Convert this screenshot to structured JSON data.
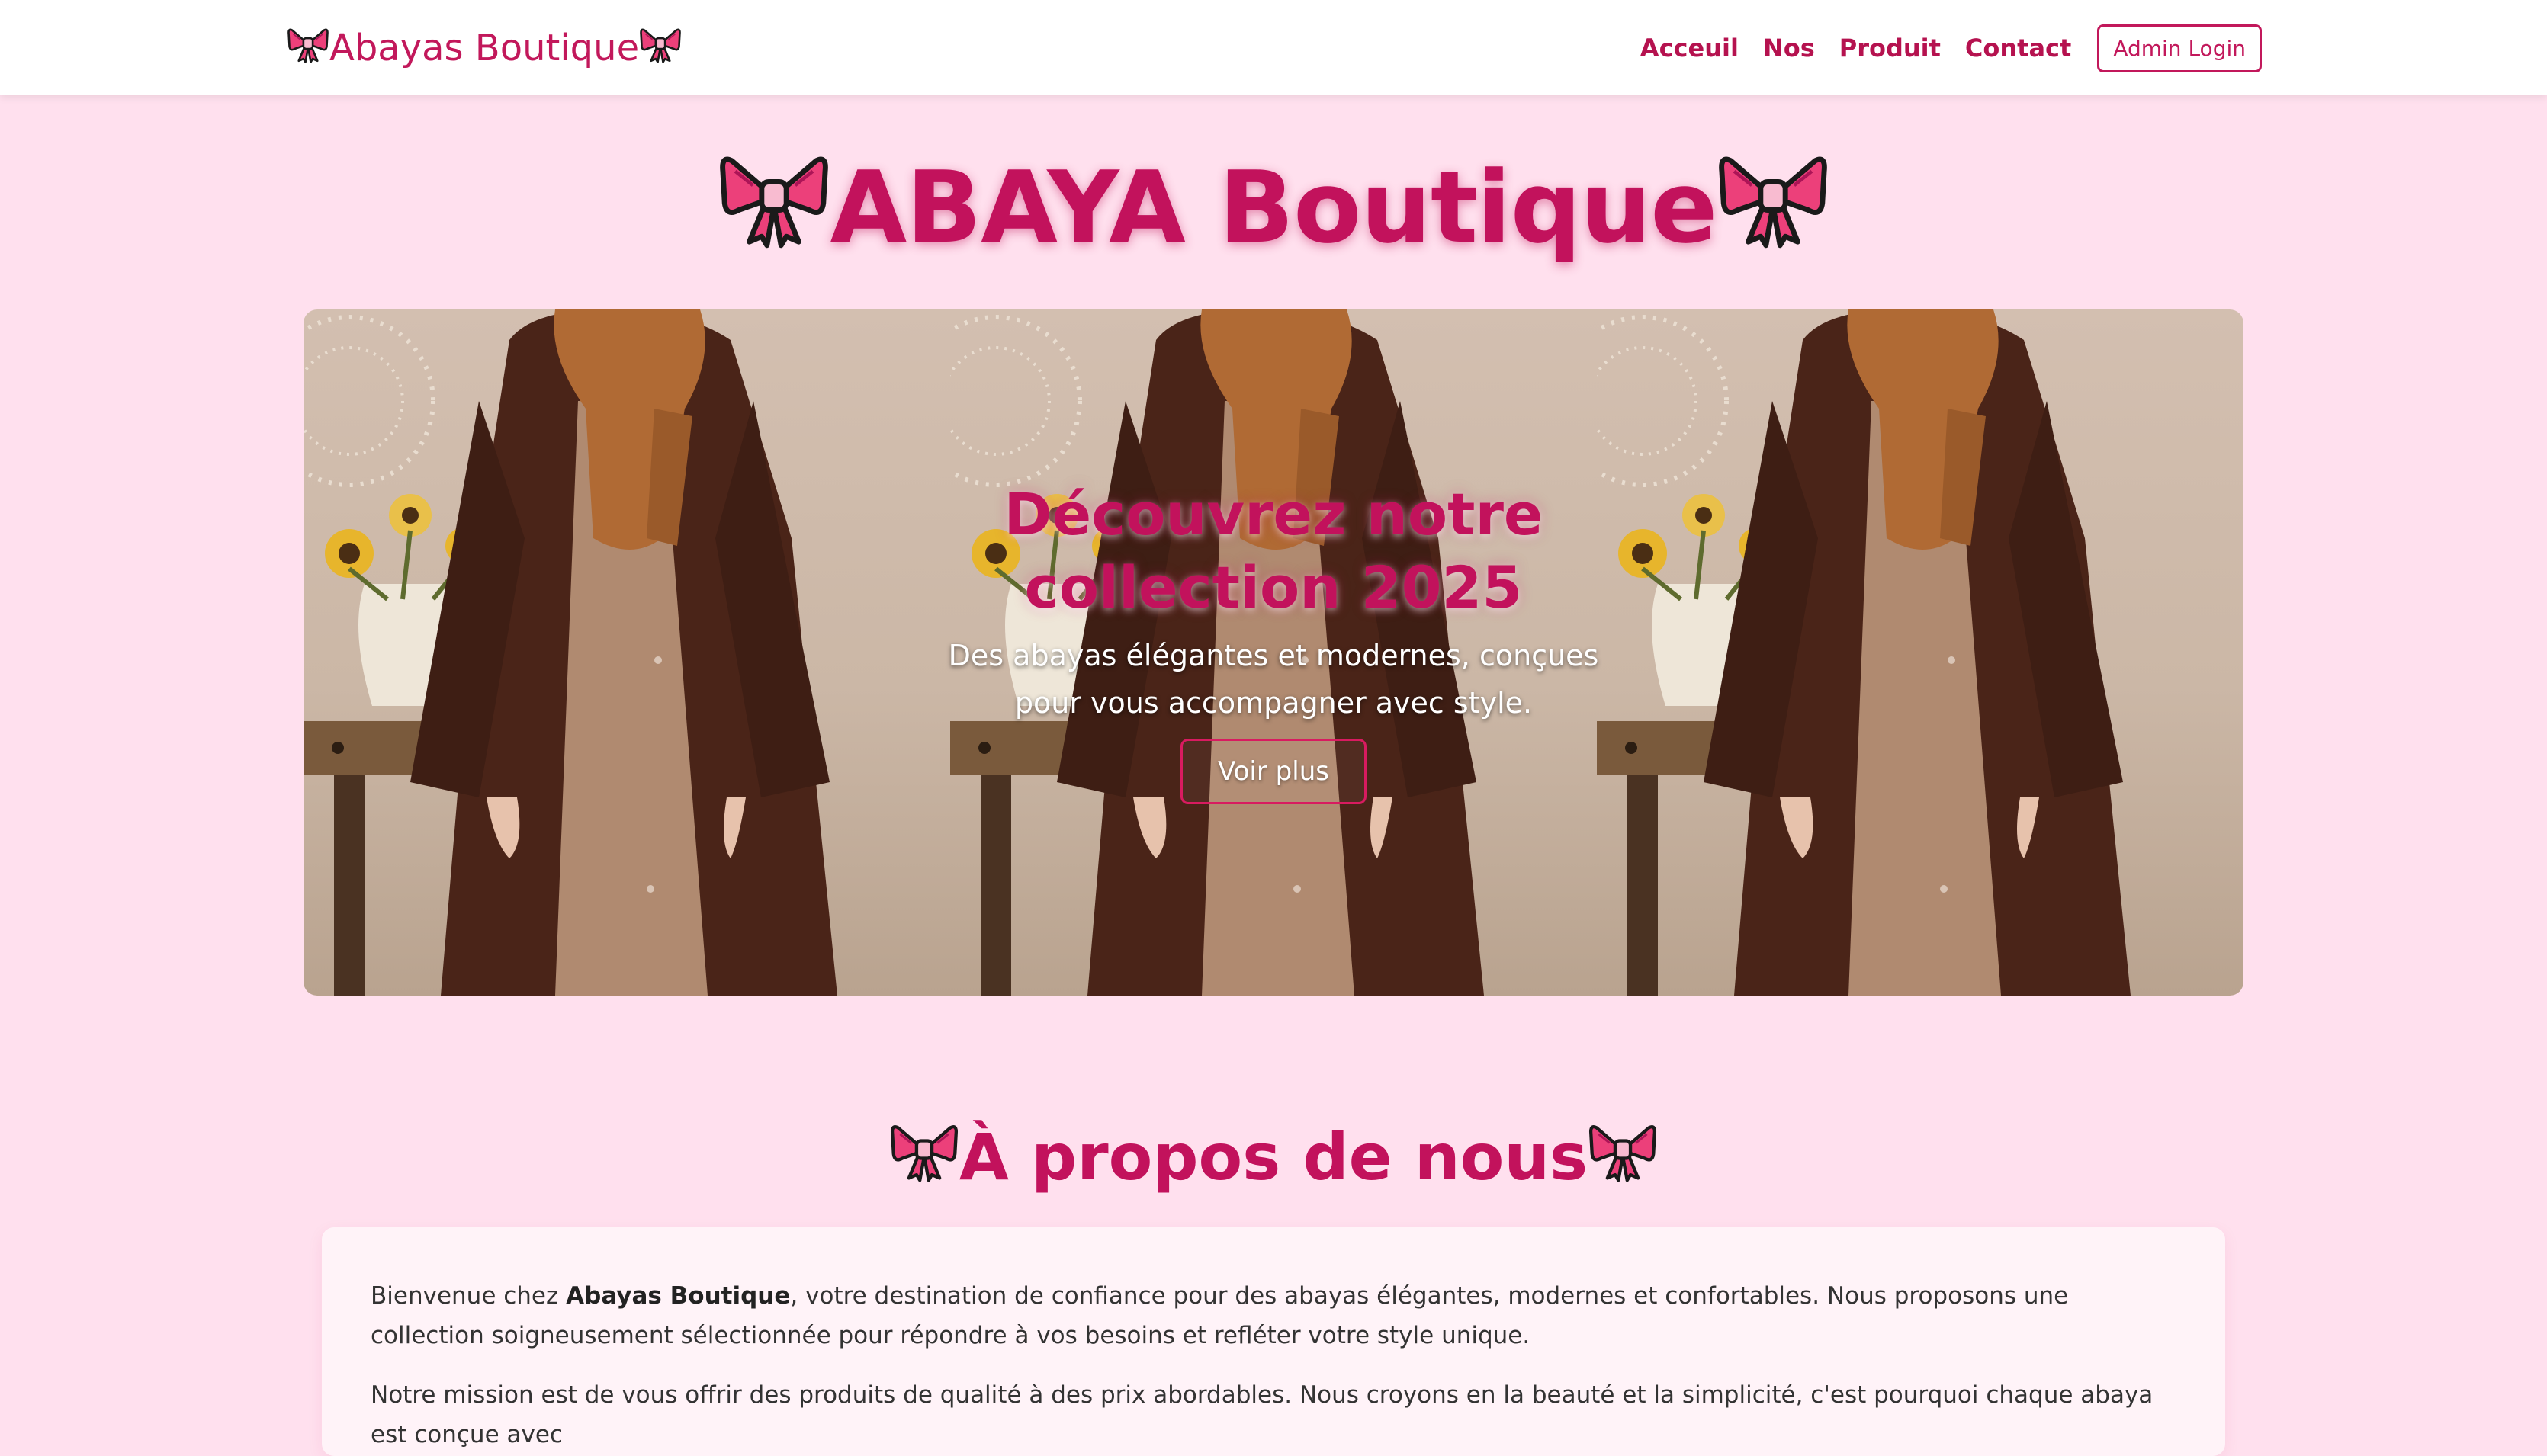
{
  "brand": {
    "name": "Abayas Boutique",
    "icon": "ribbon-bow-icon"
  },
  "nav": {
    "links": [
      "Acceuil",
      "Nos",
      "Produit",
      "Contact"
    ],
    "admin_login": "Admin Login"
  },
  "hero": {
    "title": "ABAYA Boutique"
  },
  "banner": {
    "heading": "Découvrez notre collection 2025",
    "text": "Des abayas élégantes et modernes, conçues pour vous accompagner avec style.",
    "button": "Voir plus"
  },
  "about": {
    "title": "À propos de nous",
    "intro_before": "Bienvenue chez ",
    "intro_bold": "Abayas Boutique",
    "intro_after": ", votre destination de confiance pour des abayas élégantes, modernes et confortables. Nous proposons une collection soigneusement sélectionnée pour répondre à vos besoins et refléter votre style unique.",
    "mission": "Notre mission est de vous offrir des produits de qualité à des prix abordables. Nous croyons en la beauté et la simplicité, c'est pourquoi chaque abaya est conçue avec"
  },
  "colors": {
    "primary": "#c2185b",
    "background": "#ffe0ee",
    "card": "#fff3f8",
    "bow": "#ec407a"
  }
}
